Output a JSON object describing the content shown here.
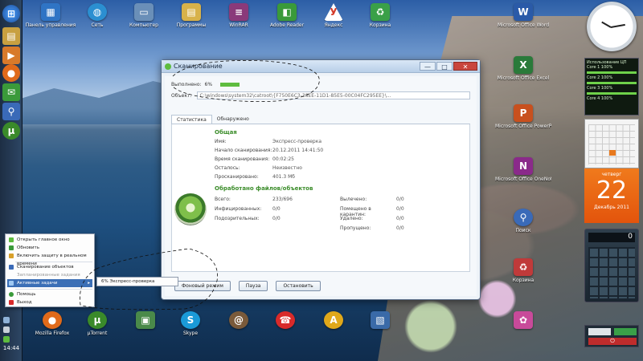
{
  "desktop": {
    "top_icons": [
      {
        "label": "Панель управления",
        "icon": "control-panel-icon",
        "color": "#2f74c5"
      },
      {
        "label": "Сеть",
        "icon": "network-icon",
        "color": "#2b8fd1"
      },
      {
        "label": "Компьютер",
        "icon": "computer-icon",
        "color": "#6a8fb8"
      },
      {
        "label": "Программы",
        "icon": "folder-icon",
        "color": "#d8b24a"
      },
      {
        "label": "WinRAR",
        "icon": "winrar-icon",
        "color": "#8a3a7a"
      },
      {
        "label": "Adobe Reader",
        "icon": "reader-icon",
        "color": "#3a9a3a"
      },
      {
        "label": "Яндекс",
        "icon": "road-sign-icon",
        "color": "#d43a2a"
      },
      {
        "label": "Корзина",
        "icon": "recycle-bin-icon",
        "color": "#3aa048"
      },
      {
        "label": "Microsoft Office Word",
        "icon": "word-icon",
        "color": "#2a5aa8"
      }
    ],
    "right_icons": [
      {
        "label": "Microsoft Office Excel",
        "icon": "excel-icon",
        "color": "#2a7a3a"
      },
      {
        "label": "Microsoft Office PowerPoint",
        "icon": "powerpoint-icon",
        "color": "#c8501e"
      },
      {
        "label": "Microsoft Office OneNote",
        "icon": "onenote-icon",
        "color": "#8a2a8a"
      },
      {
        "label": "Поиск",
        "icon": "search-icon",
        "color": "#3a6ab8"
      },
      {
        "label": "Корзина",
        "icon": "recycle-bin-icon",
        "color": "#c03a3a"
      }
    ],
    "bottom_icons": [
      {
        "label": "Mozilla Firefox",
        "icon": "firefox-icon",
        "color": "#e06a1a"
      },
      {
        "label": "µTorrent",
        "icon": "utorrent-icon",
        "color": "#3a8a2a"
      },
      {
        "label": "",
        "icon": "app-icon",
        "color": "#4a8a4a"
      },
      {
        "label": "Skype",
        "icon": "skype-icon",
        "color": "#1a9ad8"
      },
      {
        "label": "",
        "icon": "snail-icon",
        "color": "#7a5a3a"
      },
      {
        "label": "",
        "icon": "phone-icon",
        "color": "#d82a2a"
      },
      {
        "label": "",
        "icon": "warning-icon",
        "color": "#e0a81a"
      },
      {
        "label": "",
        "icon": "photo-icon",
        "color": "#3a6aa8"
      },
      {
        "label": "",
        "icon": "flower-icon",
        "color": "#c84a9a"
      }
    ]
  },
  "taskbar": {
    "clock": "14:44",
    "buttons": [
      "explorer-icon",
      "folder-icon",
      "media-icon",
      "firefox-icon",
      "outlook-icon",
      "search-icon",
      "utorrent-icon"
    ]
  },
  "window": {
    "title": "Сканирование",
    "min": "—",
    "max": "□",
    "close": "✕",
    "progress_label": "Выполнено:",
    "progress_value": "6%",
    "object_label": "Объект:",
    "object_value": "C:\\windows\\system32\\catroot\\{F750E6C3-38EE-11D1-85E5-00C04FC295EE}\\...",
    "tabs": [
      "Статистика",
      "Обнаружено"
    ],
    "general_title": "Общая",
    "general": [
      {
        "k": "Имя:",
        "v": "Экспресс-проверка"
      },
      {
        "k": "Начало сканирования:",
        "v": "20.12.2011 14:41:50"
      },
      {
        "k": "Время сканирования:",
        "v": "00:02:25"
      },
      {
        "k": "Осталось:",
        "v": "Неизвестно"
      },
      {
        "k": "Просканировано:",
        "v": "401.3 Мб"
      }
    ],
    "processed_title": "Обработано файлов/объектов",
    "processed_left": [
      {
        "k": "Всего:",
        "v": "233/696"
      },
      {
        "k": "Инфицированных:",
        "v": "0/0"
      },
      {
        "k": "Подозрительных:",
        "v": "0/0"
      }
    ],
    "processed_right": [
      {
        "k": "Вылечено:",
        "v": "0/0"
      },
      {
        "k": "Помещено в карантин:",
        "v": "0/0"
      },
      {
        "k": "Удалено:",
        "v": "0/0"
      },
      {
        "k": "Пропущено:",
        "v": "0/0"
      }
    ],
    "buttons": {
      "background": "Фоновый режим",
      "pause": "Пауза",
      "stop": "Остановить"
    }
  },
  "context_menu": {
    "items": [
      "Открыть главное окно",
      "Обновить",
      "Включить защиту в реальном времени",
      "Сканирование объектов",
      "Запланированные задания",
      "Активные задачи",
      "Помощь",
      "Выход"
    ],
    "submenu": "6% Экспресс-проверка"
  },
  "gadgets": {
    "cpu_title": "Использование ЦП",
    "cpu_rows": [
      "Core 1 100%",
      "Core 2 100%",
      "Core 3 100%",
      "Core 4 100%"
    ],
    "date_dow": "четверг",
    "date_day": "22",
    "date_month": "Декабрь 2011",
    "calc_display": "0"
  }
}
